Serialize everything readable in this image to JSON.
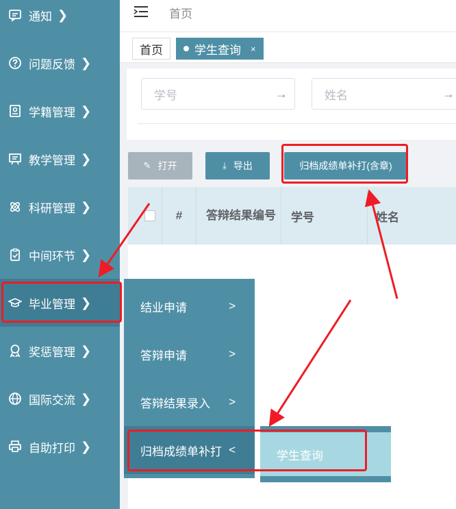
{
  "sidebar": {
    "items": [
      {
        "label": "通知",
        "icon": "message-icon"
      },
      {
        "label": "问题反馈",
        "icon": "question-icon"
      },
      {
        "label": "学籍管理",
        "icon": "id-card-icon"
      },
      {
        "label": "教学管理",
        "icon": "board-icon"
      },
      {
        "label": "科研管理",
        "icon": "atom-icon"
      },
      {
        "label": "中间环节",
        "icon": "clipboard-icon"
      },
      {
        "label": "毕业管理",
        "icon": "graduation-cap-icon"
      },
      {
        "label": "奖惩管理",
        "icon": "award-icon"
      },
      {
        "label": "国际交流",
        "icon": "globe-icon"
      },
      {
        "label": "自助打印",
        "icon": "printer-icon"
      }
    ]
  },
  "header": {
    "breadcrumb": "首页"
  },
  "tabs": [
    {
      "label": "首页"
    },
    {
      "label": "学生查询",
      "close": "×"
    }
  ],
  "search": {
    "student_id_placeholder": "学号",
    "name_placeholder": "姓名"
  },
  "toolbar": {
    "open_label": "打开",
    "export_label": "导出",
    "archive_label": "归档成绩单补打(含章)"
  },
  "table": {
    "columns": [
      "#",
      "答辩结果编号",
      "学号",
      "姓名"
    ]
  },
  "submenu": {
    "items": [
      {
        "label": "结业申请",
        "chev": ">"
      },
      {
        "label": "答辩申请",
        "chev": ">"
      },
      {
        "label": "答辩结果录入",
        "chev": ">"
      },
      {
        "label": "归档成绩单补打",
        "chev": "<"
      }
    ],
    "child": {
      "label": "学生查询"
    }
  },
  "colors": {
    "sidebar": "#4f8fa6",
    "accent": "#4f8fa6",
    "highlight": "#a7d8e2",
    "annotation": "#ee1c25"
  }
}
